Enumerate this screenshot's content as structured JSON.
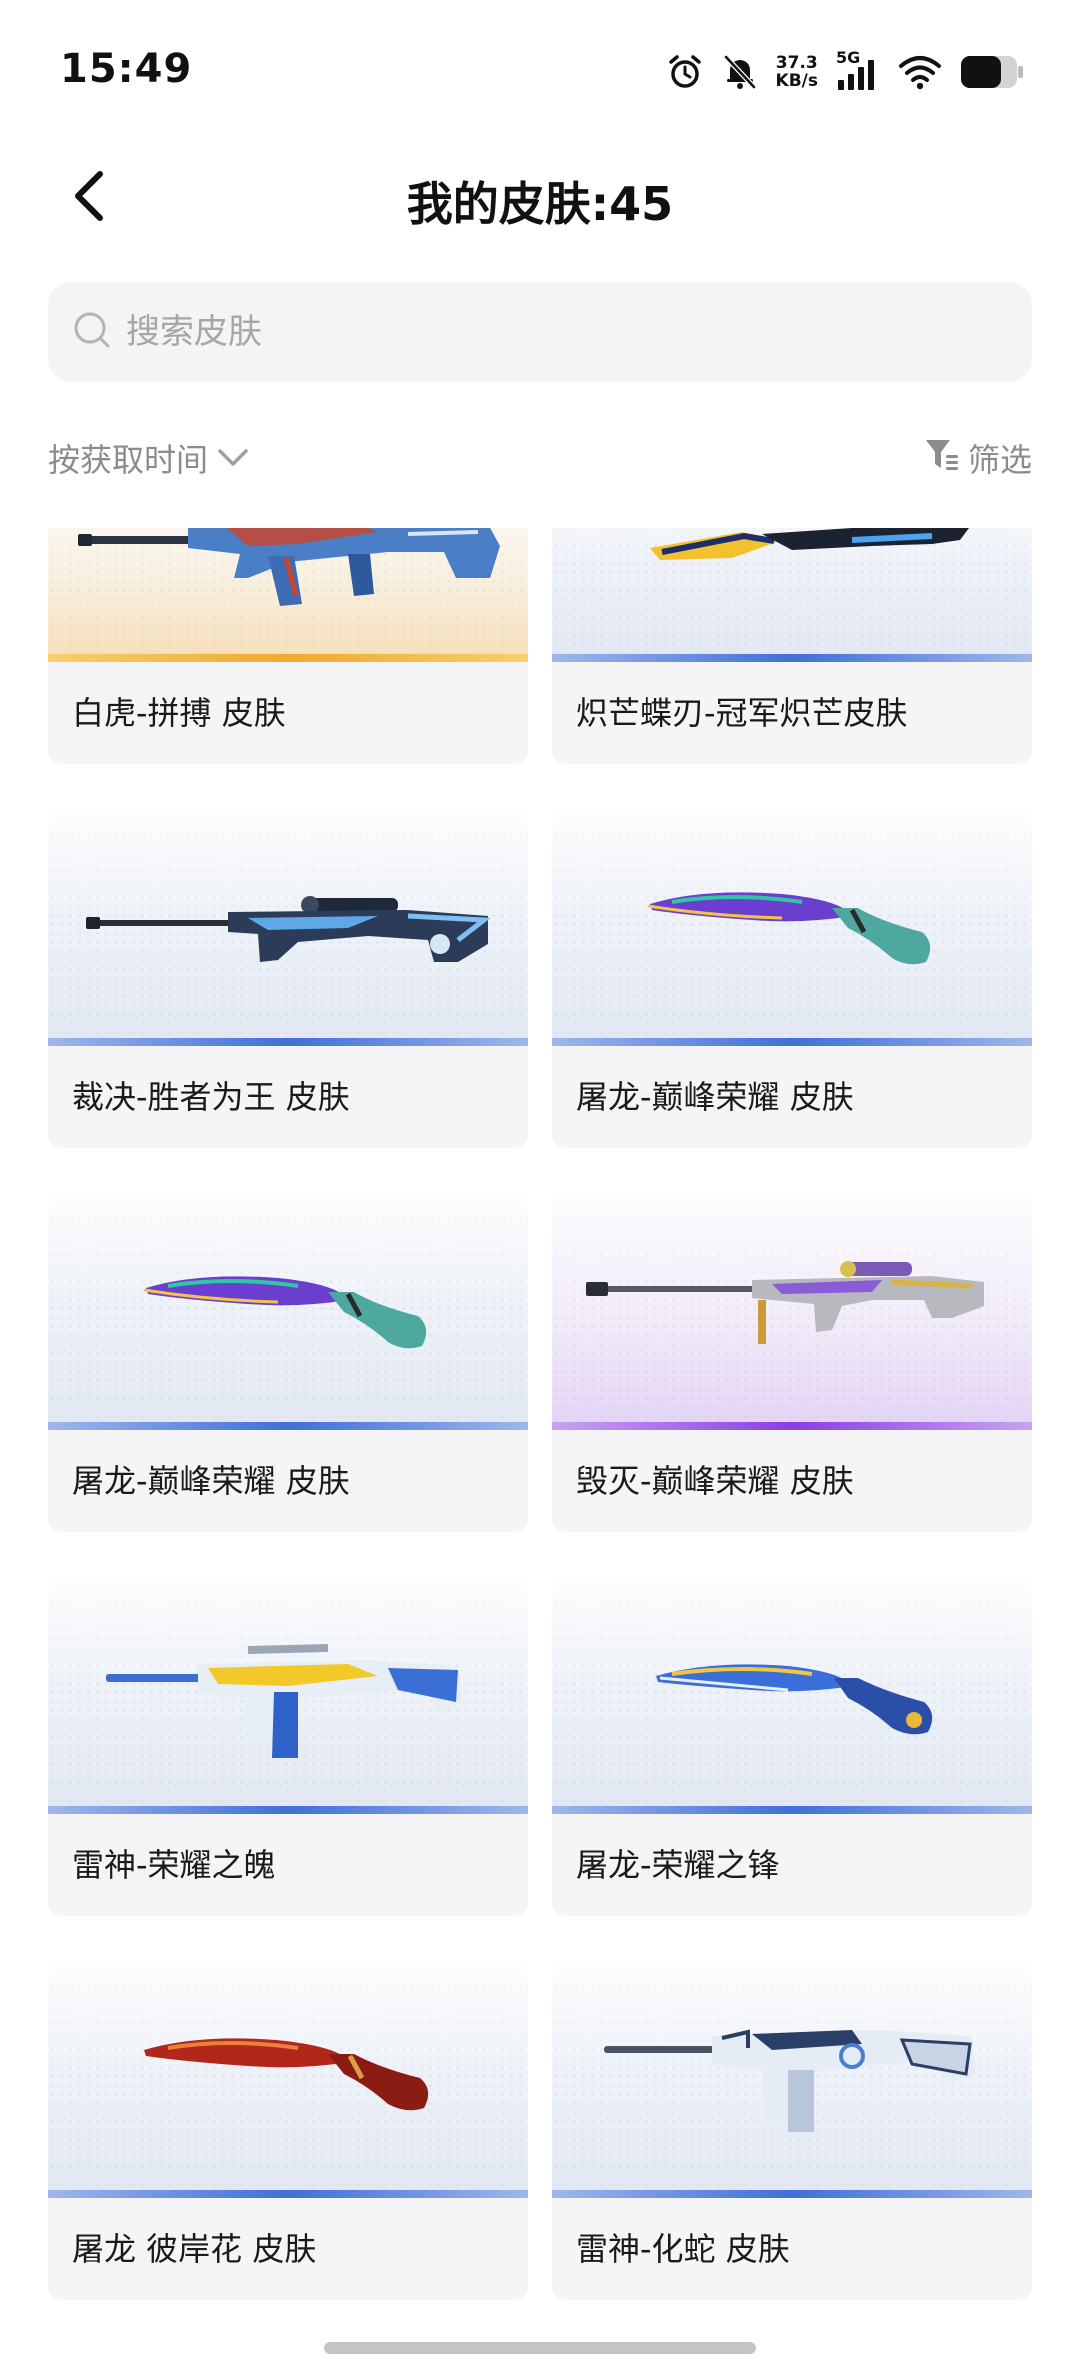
{
  "status_bar": {
    "time": "15:49",
    "net_speed_value": "37.3",
    "net_speed_unit": "KB/s",
    "signal_label": "5G",
    "icons": [
      "alarm-icon",
      "mute-bell-icon",
      "signal-icon",
      "wifi-icon",
      "battery-icon"
    ]
  },
  "header": {
    "title": "我的皮肤:45",
    "back_icon": "back-arrow-icon"
  },
  "search": {
    "placeholder": "搜索皮肤",
    "value": ""
  },
  "sort": {
    "label": "按获取时间",
    "icon": "chevron-down-icon"
  },
  "filter": {
    "label": "筛选",
    "icon": "filter-icon"
  },
  "skins": [
    {
      "name": "白虎-拼搏 皮肤",
      "weapon": "rifle",
      "rarity": "gold"
    },
    {
      "name": "炽芒蝶刃-冠军炽芒皮肤",
      "weapon": "butterfly-knife",
      "rarity": "blue"
    },
    {
      "name": "裁决-胜者为王 皮肤",
      "weapon": "sniper",
      "rarity": "blue"
    },
    {
      "name": "屠龙-巅峰荣耀 皮肤",
      "weapon": "kukri",
      "rarity": "blue"
    },
    {
      "name": "屠龙-巅峰荣耀 皮肤",
      "weapon": "kukri",
      "rarity": "blue"
    },
    {
      "name": "毁灭-巅峰荣耀 皮肤",
      "weapon": "heavy-sniper",
      "rarity": "purple"
    },
    {
      "name": "雷神-荣耀之魄",
      "weapon": "rifle",
      "rarity": "blue"
    },
    {
      "name": "屠龙-荣耀之锋",
      "weapon": "kukri",
      "rarity": "blue"
    },
    {
      "name": "屠龙 彼岸花 皮肤",
      "weapon": "kukri",
      "rarity": "blue"
    },
    {
      "name": "雷神-化蛇 皮肤",
      "weapon": "rifle",
      "rarity": "blue"
    }
  ],
  "colors": {
    "accent_blue": "#3f6fd9",
    "accent_gold": "#f0a930",
    "accent_purple": "#8b3ee5",
    "card_bg": "#f5f5f7",
    "muted_text": "#8c8c8c"
  }
}
